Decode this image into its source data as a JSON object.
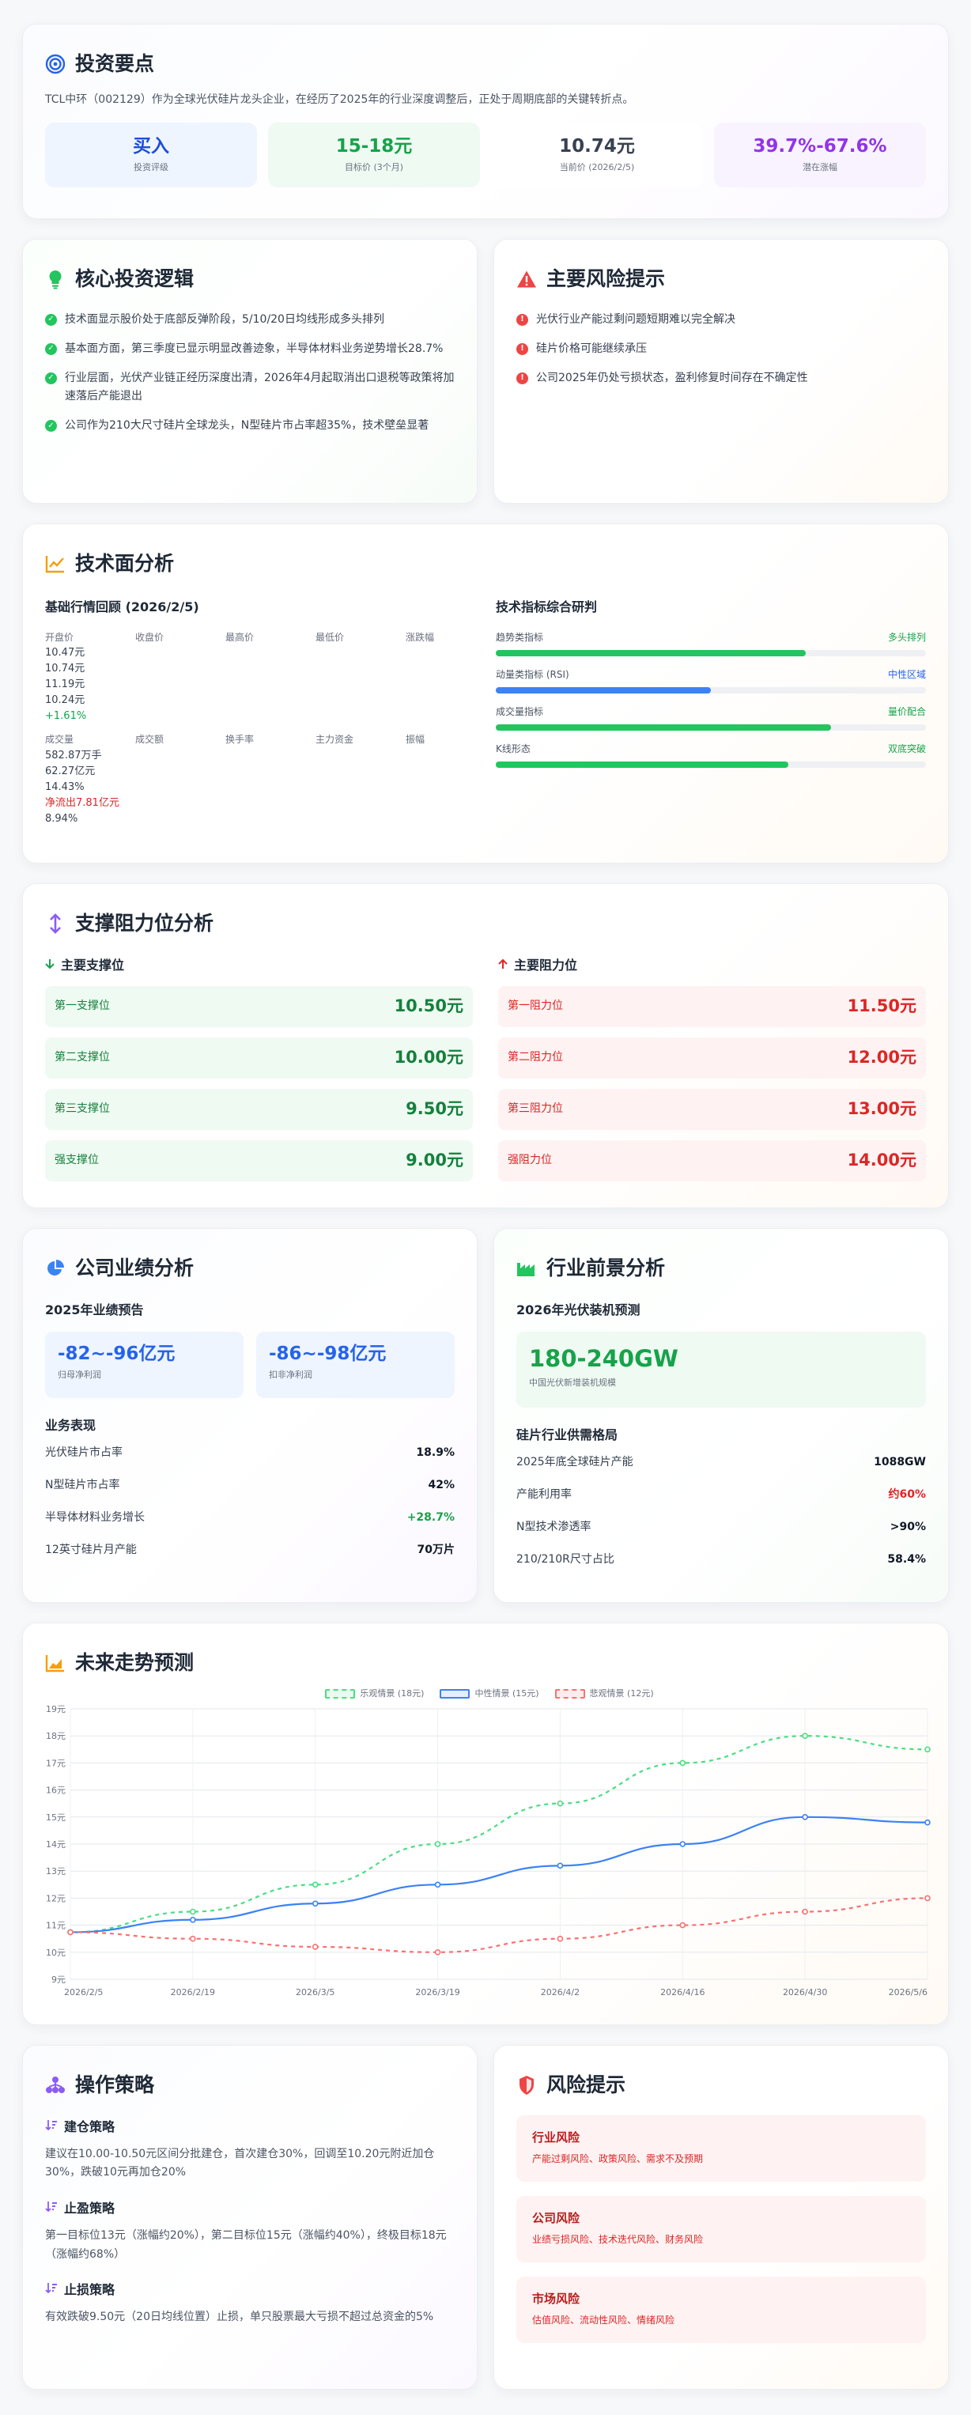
{
  "overview": {
    "title": "投资要点",
    "desc": "TCL中环（002129）作为全球光伏硅片龙头企业，在经历了2025年的行业深度调整后，正处于周期底部的关键转折点。",
    "kpis": [
      {
        "value": "买入",
        "label": "投资评级",
        "color": "#1d4ed8",
        "bg": "#eef5ff"
      },
      {
        "value": "15-18元",
        "label": "目标价 (3个月)",
        "color": "#16a34a",
        "bg": "#effaf2"
      },
      {
        "value": "10.74元",
        "label": "当前价 (2026/2/5)",
        "color": "#374151",
        "bg": "#ffffff"
      },
      {
        "value": "39.7%-67.6%",
        "label": "潜在涨幅",
        "color": "#9333ea",
        "bg": "#f9f3ff"
      }
    ]
  },
  "logic": {
    "title": "核心投资逻辑",
    "items": [
      "技术面显示股价处于底部反弹阶段，5/10/20日均线形成多头排列",
      "基本面方面，第三季度已显示明显改善迹象，半导体材料业务逆势增长28.7%",
      "行业层面，光伏产业链正经历深度出清，2026年4月起取消出口退税等政策将加速落后产能退出",
      "公司作为210大尺寸硅片全球龙头，N型硅片市占率超35%，技术壁垒显著"
    ]
  },
  "risk_main": {
    "title": "主要风险提示",
    "items": [
      "光伏行业产能过剩问题短期难以完全解决",
      "硅片价格可能继续承压",
      "公司2025年仍处亏损状态，盈利修复时间存在不确定性"
    ]
  },
  "technical": {
    "title": "技术面分析",
    "review_title": "基础行情回顾 (2026/2/5)",
    "headers1": [
      "开盘价",
      "收盘价",
      "最高价",
      "最低价",
      "涨跌幅"
    ],
    "values1": [
      "10.47元",
      "10.74元",
      "11.19元",
      "10.24元",
      "+1.61%"
    ],
    "headers2": [
      "成交量",
      "成交额",
      "换手率",
      "主力资金",
      "振幅"
    ],
    "values2": [
      "582.87万手",
      "62.27亿元",
      "14.43%",
      "净流出7.81亿元",
      "8.94%"
    ],
    "ind_title": "技术指标综合研判",
    "indicators": [
      {
        "name": "趋势类指标",
        "result": "多头排列",
        "level": 0.72,
        "color": "#22c55e"
      },
      {
        "name": "动量类指标 (RSI)",
        "result": "中性区域",
        "level": 0.5,
        "color": "#3b82f6"
      },
      {
        "name": "成交量指标",
        "result": "量价配合",
        "level": 0.78,
        "color": "#22c55e"
      },
      {
        "name": "K线形态",
        "result": "双底突破",
        "level": 0.68,
        "color": "#22c55e"
      }
    ]
  },
  "sr": {
    "title": "支撑阻力位分析",
    "support_title": "主要支撑位",
    "resistance_title": "主要阻力位",
    "support": [
      {
        "name": "第一支撑位",
        "price": "10.50元"
      },
      {
        "name": "第二支撑位",
        "price": "10.00元"
      },
      {
        "name": "第三支撑位",
        "price": "9.50元"
      },
      {
        "name": "强支撑位",
        "price": "9.00元"
      }
    ],
    "resistance": [
      {
        "name": "第一阻力位",
        "price": "11.50元"
      },
      {
        "name": "第二阻力位",
        "price": "12.00元"
      },
      {
        "name": "第三阻力位",
        "price": "13.00元"
      },
      {
        "name": "强阻力位",
        "price": "14.00元"
      }
    ]
  },
  "company": {
    "title": "公司业绩分析",
    "forecast_title": "2025年业绩预告",
    "box1": {
      "value": "-82~-96亿元",
      "label": "归母净利润"
    },
    "box2": {
      "value": "-86~-98亿元",
      "label": "扣非净利润"
    },
    "perf_title": "业务表现",
    "perf": [
      {
        "k": "光伏硅片市占率",
        "v": "18.9%",
        "color": "#111827"
      },
      {
        "k": "N型硅片市占率",
        "v": "42%",
        "color": "#111827"
      },
      {
        "k": "半导体材料业务增长",
        "v": "+28.7%",
        "color": "#16a34a"
      },
      {
        "k": "12英寸硅片月产能",
        "v": "70万片",
        "color": "#111827"
      }
    ]
  },
  "industry": {
    "title": "行业前景分析",
    "forecast_title": "2026年光伏装机预测",
    "box": {
      "value": "180-240GW",
      "label": "中国光伏新增装机规模"
    },
    "supply_title": "硅片行业供需格局",
    "rows": [
      {
        "k": "2025年底全球硅片产能",
        "v": "1088GW",
        "color": "#111827"
      },
      {
        "k": "产能利用率",
        "v": "约60%",
        "color": "#dc2626"
      },
      {
        "k": "N型技术渗透率",
        "v": ">90%",
        "color": "#111827"
      },
      {
        "k": "210/210R尺寸占比",
        "v": "58.4%",
        "color": "#111827"
      }
    ]
  },
  "forecast": {
    "title": "未来走势预测"
  },
  "chart_data": {
    "type": "line",
    "categories": [
      "2026/2/5",
      "2026/2/19",
      "2026/3/5",
      "2026/3/19",
      "2026/4/2",
      "2026/4/16",
      "2026/4/30",
      "2026/5/6"
    ],
    "ylim": [
      9,
      19
    ],
    "yticks": [
      "9元",
      "10元",
      "11元",
      "12元",
      "13元",
      "14元",
      "15元",
      "16元",
      "17元",
      "18元",
      "19元"
    ],
    "series": [
      {
        "name": "乐观情景 (18元)",
        "values": [
          10.74,
          11.5,
          12.5,
          14.0,
          15.5,
          17.0,
          18.0,
          17.5
        ],
        "color": "#4ade80",
        "dashed": true
      },
      {
        "name": "中性情景 (15元)",
        "values": [
          10.74,
          11.2,
          11.8,
          12.5,
          13.2,
          14.0,
          15.0,
          14.8
        ],
        "color": "#3b82f6",
        "dashed": false
      },
      {
        "name": "悲观情景 (12元)",
        "values": [
          10.74,
          10.5,
          10.2,
          10.0,
          10.5,
          11.0,
          11.5,
          12.0
        ],
        "color": "#f87171",
        "dashed": true
      }
    ],
    "grid": true,
    "legend": "top"
  },
  "strategy": {
    "title": "操作策略",
    "items": [
      {
        "h": "建仓策略",
        "t": "建议在10.00-10.50元区间分批建仓，首次建仓30%，回调至10.20元附近加仓30%，跌破10元再加仓20%"
      },
      {
        "h": "止盈策略",
        "t": "第一目标位13元（涨幅约20%），第二目标位15元（涨幅约40%），终极目标18元（涨幅约68%）"
      },
      {
        "h": "止损策略",
        "t": "有效跌破9.50元（20日均线位置）止损，单只股票最大亏损不超过总资金的5%"
      }
    ]
  },
  "risks": {
    "title": "风险提示",
    "items": [
      {
        "h": "行业风险",
        "t": "产能过剩风险、政策风险、需求不及预期"
      },
      {
        "h": "公司风险",
        "t": "业绩亏损风险、技术迭代风险、财务风险"
      },
      {
        "h": "市场风险",
        "t": "估值风险、流动性风险、情绪风险"
      }
    ]
  }
}
